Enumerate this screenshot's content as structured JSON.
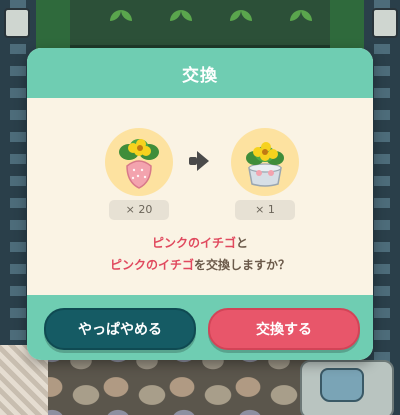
{
  "dialog": {
    "title": "交換",
    "from_item": {
      "icon": "pink-strawberry-icon",
      "quantity": "× 20"
    },
    "to_item": {
      "icon": "potted-yellow-flower-icon",
      "quantity": "× 1"
    },
    "message": {
      "line1_item": "ピンクのイチゴ",
      "line1_suffix": "と",
      "line2_item": "ピンクのイチゴ",
      "line2_suffix": "を交換しますか？"
    },
    "cancel_label": "やっぱやめる",
    "confirm_label": "交換する"
  },
  "colors": {
    "header": "#6fcdb2",
    "panel": "#faf3e4",
    "highlight": "#e0495e",
    "cancel_button": "#155b64",
    "confirm_button": "#e8566a"
  }
}
